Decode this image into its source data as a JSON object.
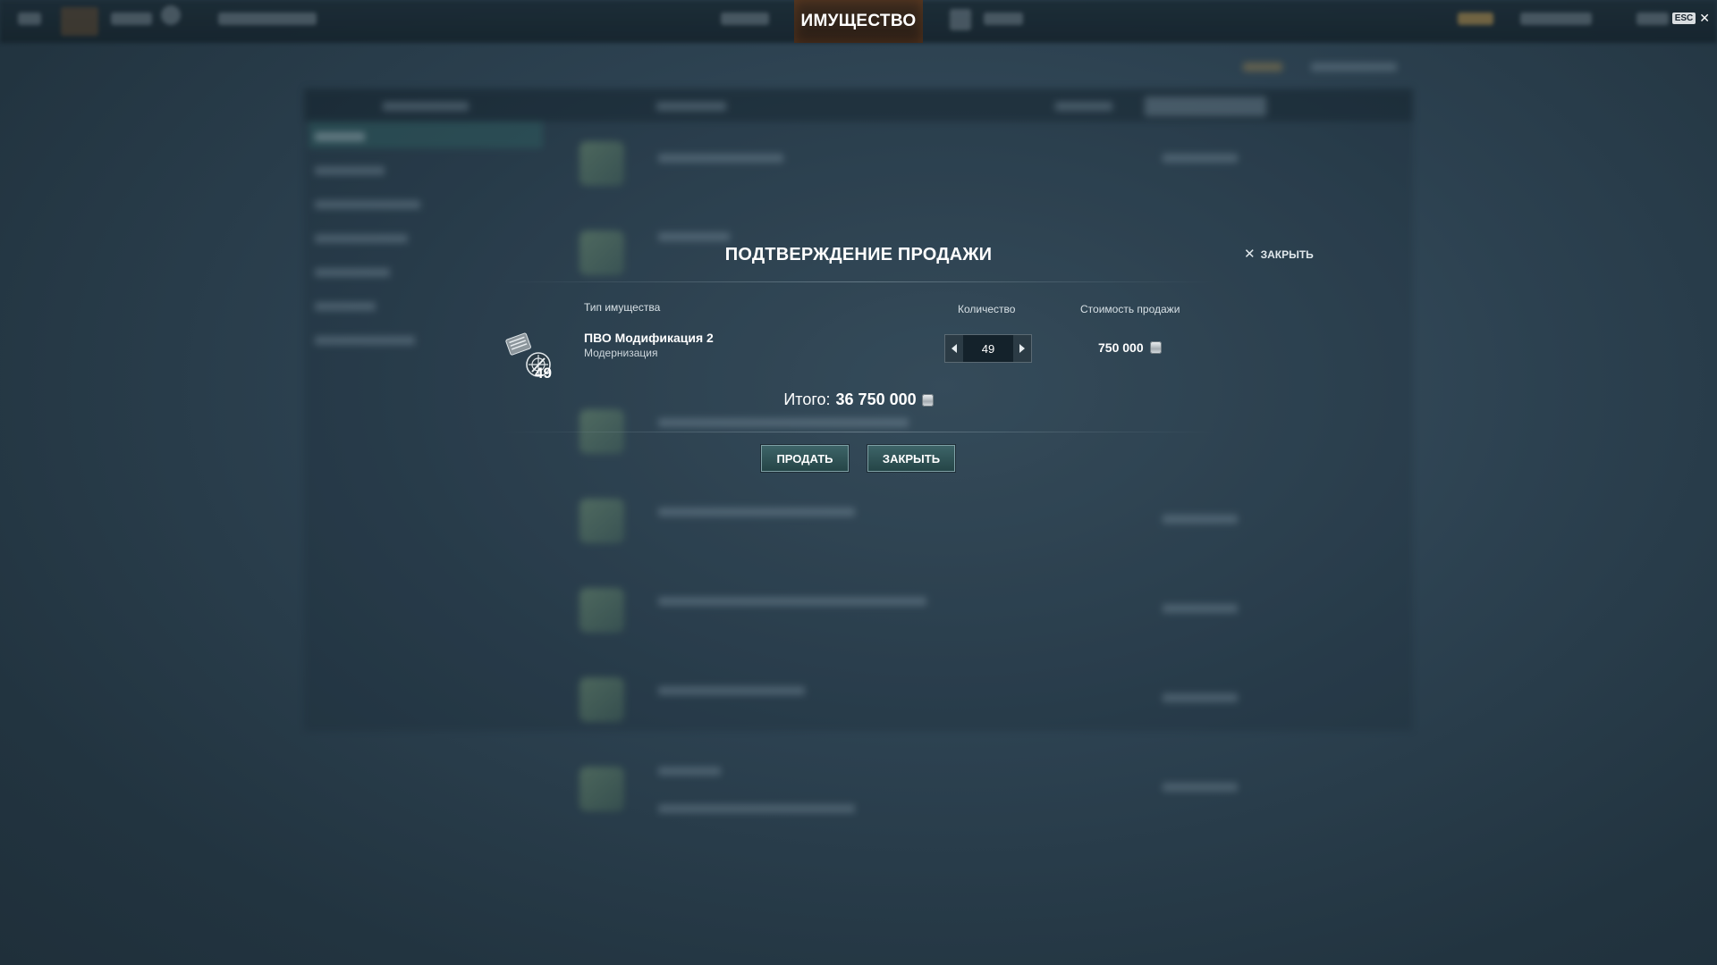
{
  "topbar": {
    "active_tab": "ИМУЩЕСТВО",
    "esc_key": "ESC",
    "esc_close": "✕"
  },
  "dialog": {
    "title": "ПОДТВЕРЖДЕНИЕ ПРОДАЖИ",
    "close_link_label": "ЗАКРЫТЬ",
    "columns": {
      "type": "Тип имущества",
      "quantity": "Количество",
      "price": "Стоимость продажи"
    },
    "item": {
      "name": "ПВО Модификация 2",
      "type": "Модернизация",
      "owned_count": "49",
      "quantity_value": "49",
      "unit_price": "750 000"
    },
    "total_label": "Итого:",
    "total_value": "36 750 000",
    "buttons": {
      "sell": "ПРОДАТЬ",
      "close": "ЗАКРЫТЬ"
    }
  },
  "icons": {
    "close": "close-icon",
    "credit": "credit-coin-icon",
    "decrement": "arrow-left-icon",
    "increment": "arrow-right-icon",
    "item": "aa-upgrade-icon"
  },
  "colors": {
    "accent_button": "#2f5558",
    "active_tab_bg": "#33261c",
    "background": "#2c4150"
  }
}
